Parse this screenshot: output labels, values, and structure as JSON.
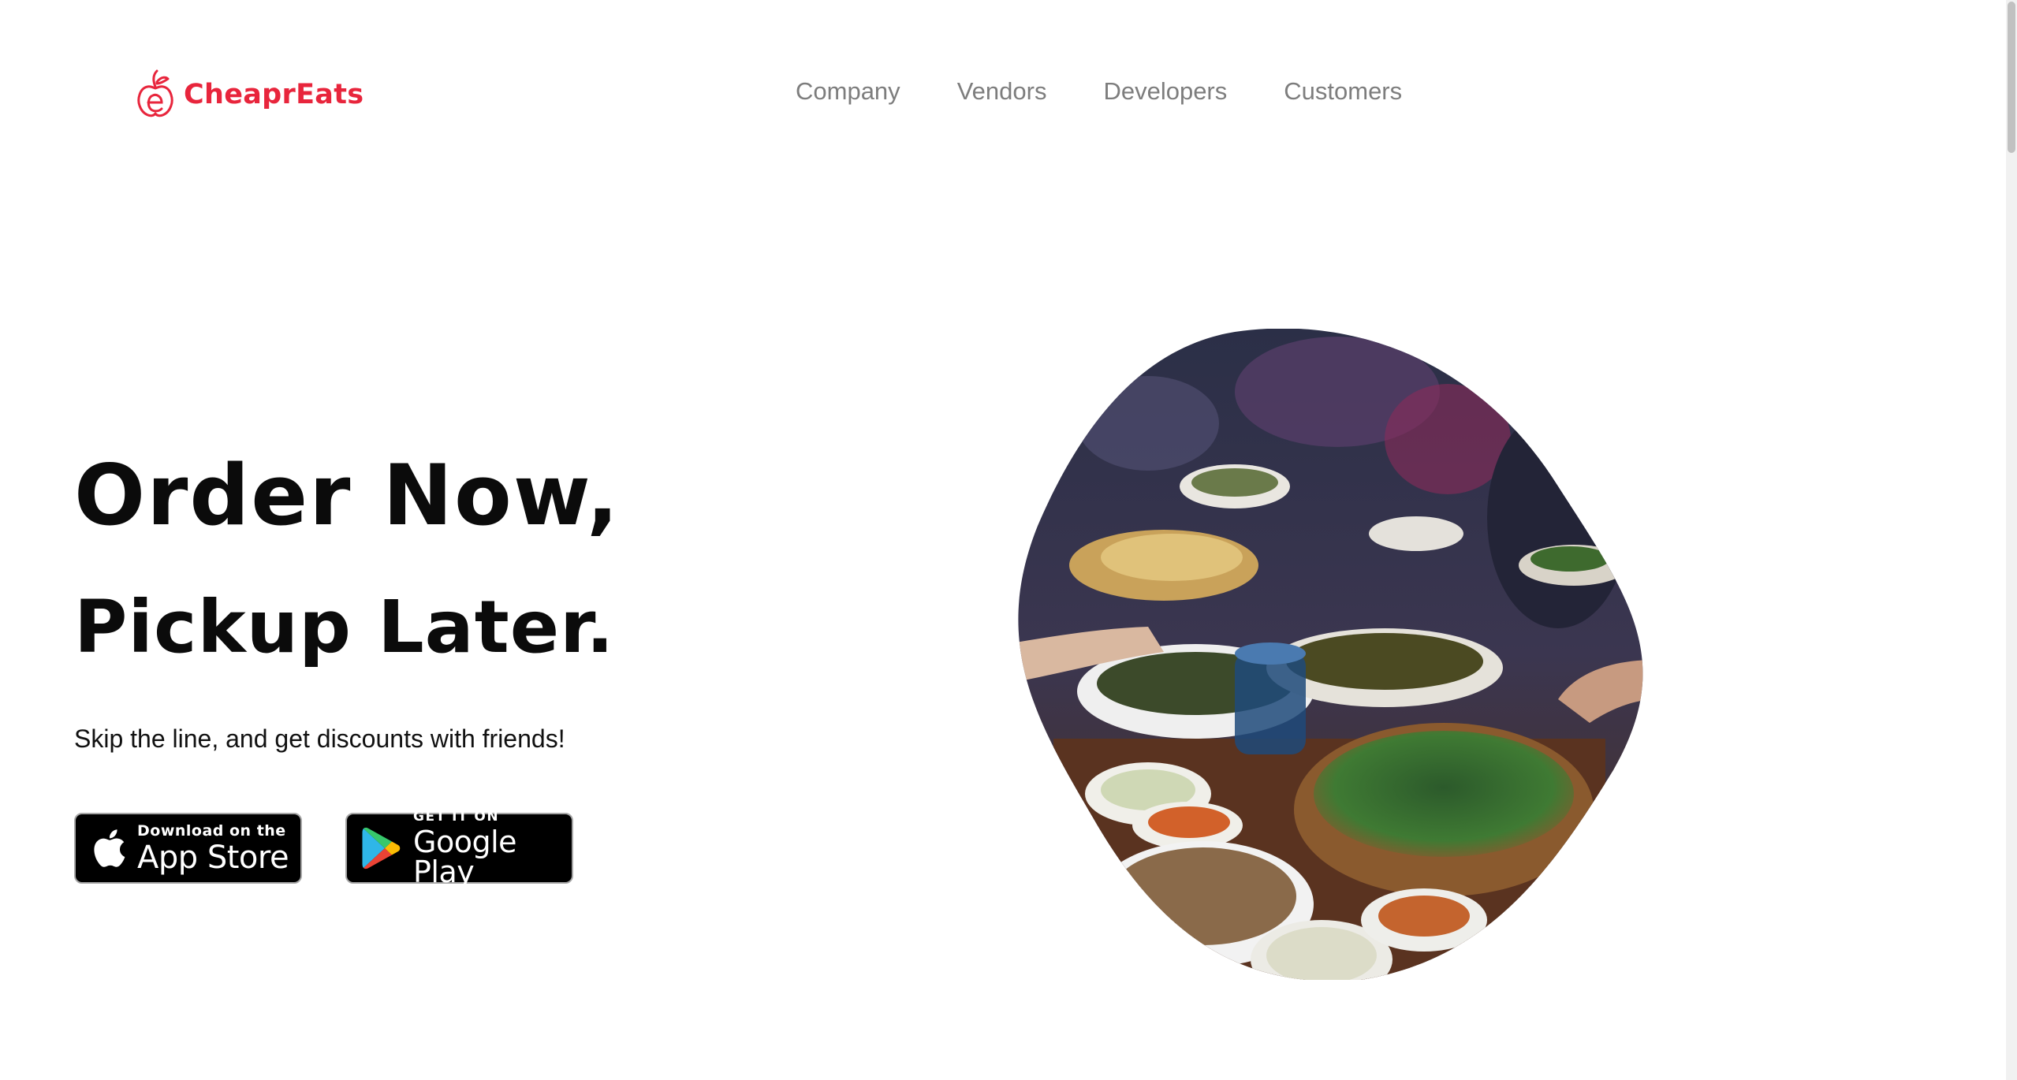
{
  "brand": {
    "name": "CheaprEats",
    "color": "#e8253c",
    "icon": "apple-logo-icon"
  },
  "nav": {
    "items": [
      {
        "label": "Company"
      },
      {
        "label": "Vendors"
      },
      {
        "label": "Developers"
      },
      {
        "label": "Customers"
      }
    ]
  },
  "hero": {
    "line1": "Order Now,",
    "line2": "Pickup Later.",
    "subtitle": "Skip the line, and get discounts with friends!",
    "image_alt": "food-table-photo"
  },
  "stores": {
    "apple": {
      "small": "Download on the",
      "big": "App Store",
      "icon": "apple-icon"
    },
    "google": {
      "small": "GET IT ON",
      "big": "Google Play",
      "icon": "google-play-icon"
    }
  }
}
